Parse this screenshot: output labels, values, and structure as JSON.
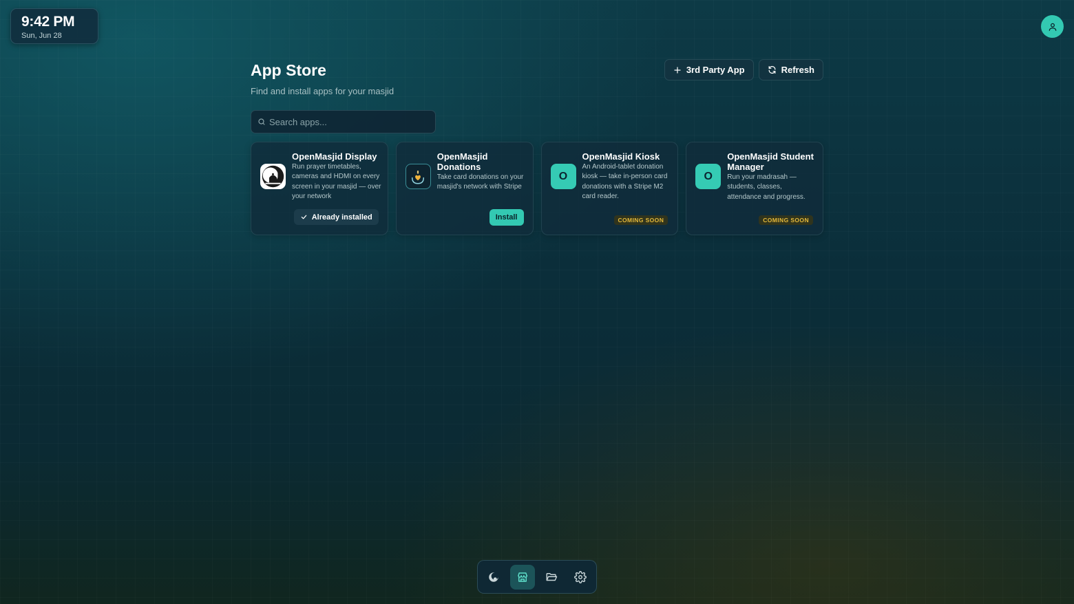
{
  "clock": {
    "time": "9:42 PM",
    "date": "Sun, Jun 28"
  },
  "user": {
    "avatar_icon": "user-icon"
  },
  "page": {
    "title": "App Store",
    "subtitle": "Find and install apps for your masjid"
  },
  "actions": {
    "third_party": {
      "label": "3rd Party App",
      "icon": "plus-icon"
    },
    "refresh": {
      "label": "Refresh",
      "icon": "refresh-icon"
    }
  },
  "search": {
    "value": "",
    "placeholder": "Search apps..."
  },
  "apps": [
    {
      "name": "OpenMasjid Display",
      "description": "Run prayer timetables, cameras and HDMI on every screen in your masjid — over your network",
      "status": "Already installed",
      "icon": "mosque-logo-icon"
    },
    {
      "name": "OpenMasjid Donations",
      "description": "Take card donations on your masjid's network with Stripe",
      "status": "Install",
      "icon": "donation-heart-icon"
    },
    {
      "name": "OpenMasjid Kiosk",
      "description": "An Android-tablet donation kiosk — take in-person card donations with a Stripe M2 card reader.",
      "status": "COMING SOON",
      "icon_letter": "O"
    },
    {
      "name": "OpenMasjid Student Manager",
      "description": "Run your madrasah — students, classes, attendance and progress.",
      "status": "COMING SOON",
      "icon_letter": "O"
    }
  ],
  "dock": [
    {
      "icon": "crescent-logo-icon",
      "active": false
    },
    {
      "icon": "store-icon",
      "active": true
    },
    {
      "icon": "folder-icon",
      "active": false
    },
    {
      "icon": "settings-icon",
      "active": false
    }
  ],
  "colors": {
    "accent": "#33c9b2",
    "coming_soon": "#e5b93a",
    "background": "#0b2e3a"
  }
}
